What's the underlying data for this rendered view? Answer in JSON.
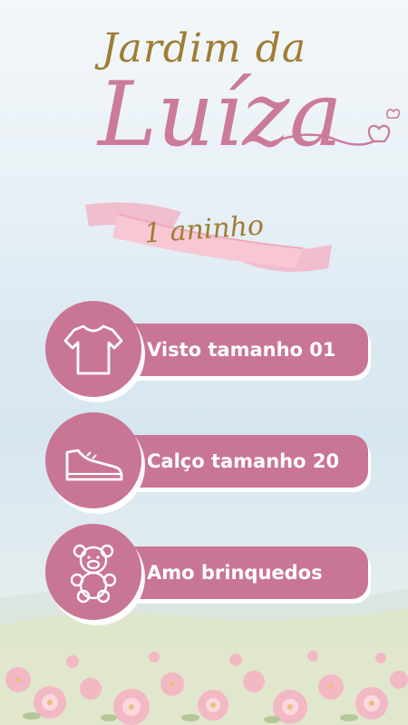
{
  "header": {
    "line1": "Jardim da",
    "name": "Luíza",
    "age": "1 aninho"
  },
  "colors": {
    "pink": "#c97596",
    "gold": "#a07d34",
    "name_pink": "#cc7a9c"
  },
  "items": [
    {
      "icon": "tshirt-icon",
      "label": "Visto tamanho 01"
    },
    {
      "icon": "sneaker-icon",
      "label": "Calço tamanho 20"
    },
    {
      "icon": "teddy-bear-icon",
      "label": "Amo brinquedos"
    }
  ]
}
